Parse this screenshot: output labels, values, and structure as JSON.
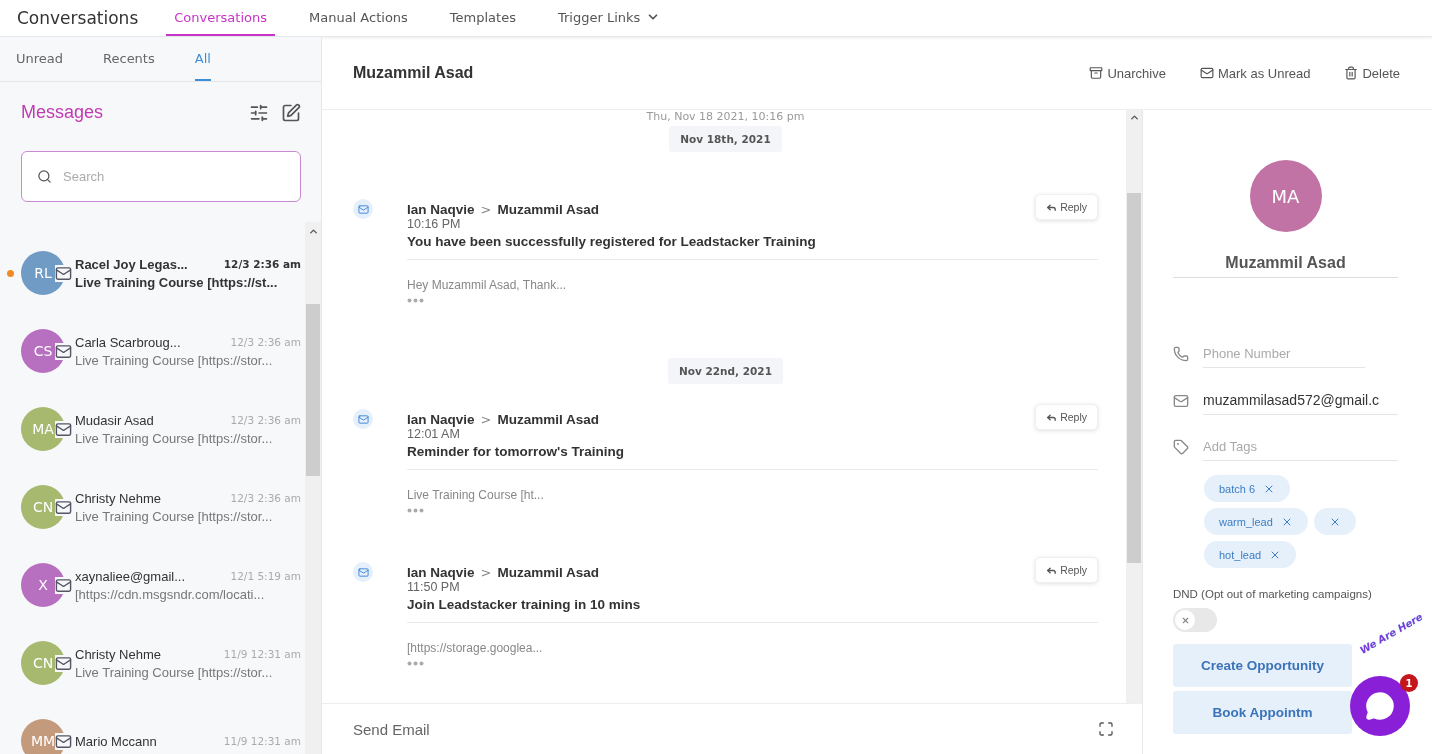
{
  "app_title": "Conversations",
  "nav": [
    {
      "label": "Conversations",
      "selected": true,
      "dropdown": false
    },
    {
      "label": "Manual Actions",
      "selected": false,
      "dropdown": false
    },
    {
      "label": "Templates",
      "selected": false,
      "dropdown": false
    },
    {
      "label": "Trigger Links",
      "selected": false,
      "dropdown": true
    }
  ],
  "filter_tabs": [
    {
      "label": "Unread",
      "selected": false
    },
    {
      "label": "Recents",
      "selected": false
    },
    {
      "label": "All",
      "selected": true
    }
  ],
  "messages_title": "Messages",
  "search": {
    "placeholder": "Search"
  },
  "conversations": [
    {
      "initials": "RL",
      "color": "#6f9bc4",
      "name": "Racel Joy Legas...",
      "time": "12/3 2:36 am",
      "preview": "Live Training Course [https://st...",
      "unread": true
    },
    {
      "initials": "CS",
      "color": "#b76fc0",
      "name": "Carla Scarbroug...",
      "time": "12/3 2:36 am",
      "preview": "Live Training Course [https://stor...",
      "unread": false
    },
    {
      "initials": "MA",
      "color": "#a6b96e",
      "name": "Mudasir Asad",
      "time": "12/3 2:36 am",
      "preview": "Live Training Course [https://stor...",
      "unread": false
    },
    {
      "initials": "CN",
      "color": "#a6b96e",
      "name": "Christy Nehme",
      "time": "12/3 2:36 am",
      "preview": "Live Training Course [https://stor...",
      "unread": false
    },
    {
      "initials": "X",
      "color": "#b76fc0",
      "name": "xaynaliee@gmail...",
      "time": "12/1 5:19 am",
      "preview": "[https://cdn.msgsndr.com/locati...",
      "unread": false
    },
    {
      "initials": "CN",
      "color": "#a6b96e",
      "name": "Christy Nehme",
      "time": "11/9 12:31 am",
      "preview": "Live Training Course [https://stor...",
      "unread": false
    },
    {
      "initials": "MM",
      "color": "#c49a7c",
      "name": "Mario Mccann",
      "time": "11/9 12:31 am",
      "unread": false
    }
  ],
  "contact_name": "Muzammil Asad",
  "actions": [
    {
      "label": "Unarchive",
      "kind": "archive"
    },
    {
      "label": "Mark as Unread",
      "kind": "mail"
    },
    {
      "label": "Delete",
      "kind": "trash"
    }
  ],
  "thread_top_stamp": "Thu, Nov 18 2021, 10:16 pm",
  "thread": [
    {
      "kind": "date",
      "label": "Nov 18th, 2021"
    },
    {
      "kind": "email",
      "from": "Ian Naqvie",
      "separator": ">",
      "to": "Muzammil Asad",
      "time": "10:16 PM",
      "subject": "You have been successfully registered for Leadstacker Training",
      "snippet": "Hey Muzammil Asad, Thank...",
      "reply": "Reply"
    },
    {
      "kind": "date",
      "label": "Nov 22nd, 2021"
    },
    {
      "kind": "email",
      "from": "Ian Naqvie",
      "separator": ">",
      "to": "Muzammil Asad",
      "time": "12:01 AM",
      "subject": "Reminder for tomorrow's Training",
      "snippet": "Live Training Course [ht...",
      "reply": "Reply"
    },
    {
      "kind": "email",
      "from": "Ian Naqvie",
      "separator": ">",
      "to": "Muzammil Asad",
      "time": "11:50 PM",
      "subject": "Join Leadstacker training in 10 mins",
      "snippet": "[https://storage.googlea...",
      "reply": "Reply"
    }
  ],
  "composer": {
    "label": "Send Email"
  },
  "profile": {
    "initials": "MA",
    "name": "Muzammil Asad",
    "phone": {
      "placeholder": "Phone Number"
    },
    "email": {
      "value": "muzammilasad572@gmail.c"
    },
    "tags_field": {
      "placeholder": "Add Tags"
    },
    "tags": [
      {
        "kind": "text",
        "label": "batch 6"
      },
      {
        "kind": "text",
        "label": "warm_lead"
      },
      {
        "kind": "blank"
      },
      {
        "kind": "text",
        "label": "hot_lead"
      }
    ],
    "dnd_label": "DND (Opt out of marketing campaigns)",
    "dnd_on": false,
    "buttons": [
      "Create Opportunity",
      "Book Appointm"
    ]
  },
  "chat_widget": {
    "tagline": "We Are Here",
    "badge": "1"
  }
}
